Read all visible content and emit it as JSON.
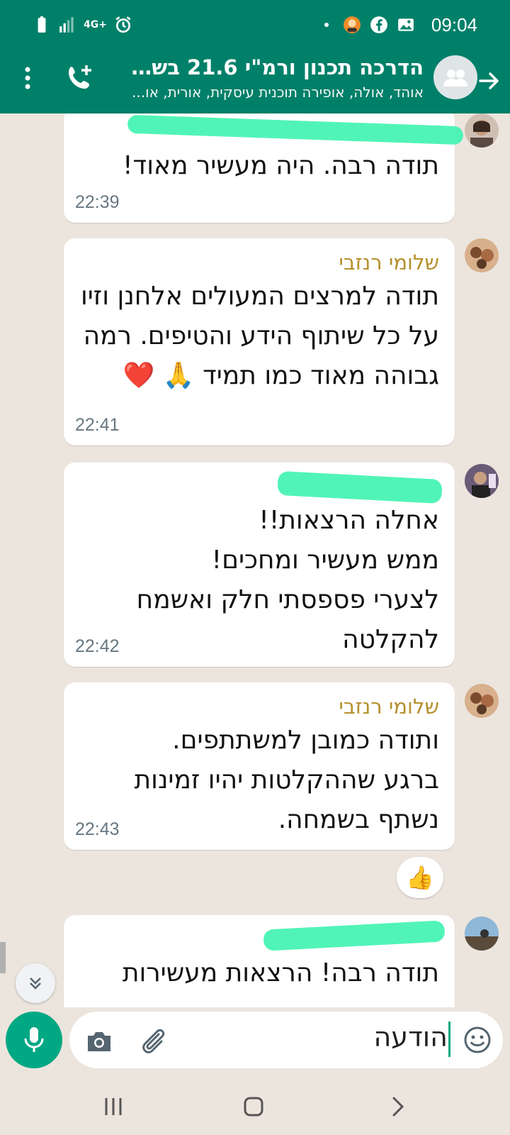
{
  "status_bar": {
    "time": "09:04",
    "network": "4G+"
  },
  "header": {
    "title": "הדרכה תכנון ורמ\"י 21.6 בשעה...",
    "subtitle": "אוהד, אולה, אופירה תוכנית עיסקית, אורית, או...",
    "icons": [
      "back-arrow-icon",
      "group-avatar-icon",
      "add-call-icon",
      "more-menu-icon"
    ]
  },
  "messages": [
    {
      "sender": "",
      "text": "תודה רבה. היה מעשיר מאוד!",
      "time": "22:39"
    },
    {
      "sender": "שלומי רנזבי",
      "sender_color": "#b5902c",
      "text": "תודה למרצים המעולים אלחנן וזיו על כל שיתוף הידע והטיפים. רמה גבוהה מאוד כמו תמיד 🙏 ❤️",
      "time": "22:41"
    },
    {
      "sender": "",
      "text": "אחלה הרצאות!!\nממש מעשיר ומחכים!\nלצערי פספסתי חלק ואשמח להקלטה",
      "time": "22:42"
    },
    {
      "sender": "שלומי רנזבי",
      "sender_color": "#b5902c",
      "text": "ותודה כמובן למשתתפים.\nברגע שההקלטות יהיו זמינות נשתף בשמחה.",
      "time": "22:43"
    },
    {
      "sender": "",
      "text": "תודה רבה! הרצאות מעשירות",
      "time": ""
    }
  ],
  "reaction": {
    "emoji": "👍"
  },
  "composer": {
    "placeholder": "הודעה"
  },
  "colors": {
    "brand": "#008069",
    "accent": "#00a884",
    "chat_bg": "#ece5dd",
    "redaction": "#3ef3b0"
  }
}
